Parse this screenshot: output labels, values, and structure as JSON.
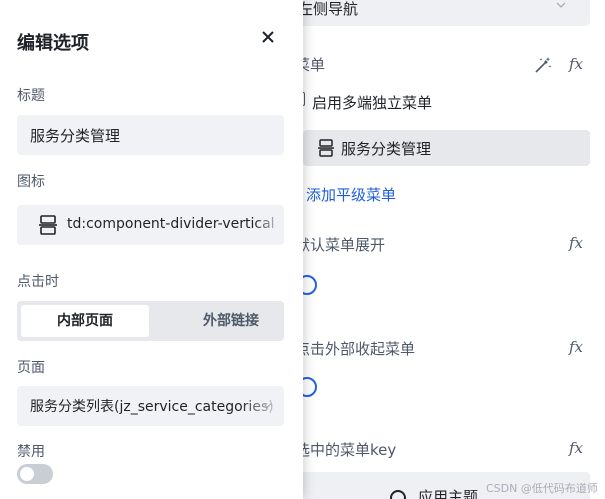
{
  "background": {
    "top_select": "左侧导航",
    "section_label": "菜单",
    "multi_end_option": "启用多端独立菜单",
    "menu_item": "服务分类管理",
    "add_sibling": "添加平级菜单",
    "expand_label": "默认菜单展开",
    "collapse_label": "点击外部收起菜单",
    "selected_key_label": "选中的菜单key",
    "apply_theme": "应用主题",
    "fx_symbol": "fx",
    "watermark": "CSDN @低代码布道师"
  },
  "drawer": {
    "title": "编辑选项",
    "title_label": "标题",
    "title_value": "服务分类管理",
    "icon_label": "图标",
    "icon_value": "td:component-divider-vertical",
    "click_label": "点击时",
    "click_options": [
      "内部页面",
      "外部链接"
    ],
    "page_label": "页面",
    "page_value": "服务分类列表(jz_service_categories)",
    "disabled_label": "禁用",
    "disabled": false
  }
}
